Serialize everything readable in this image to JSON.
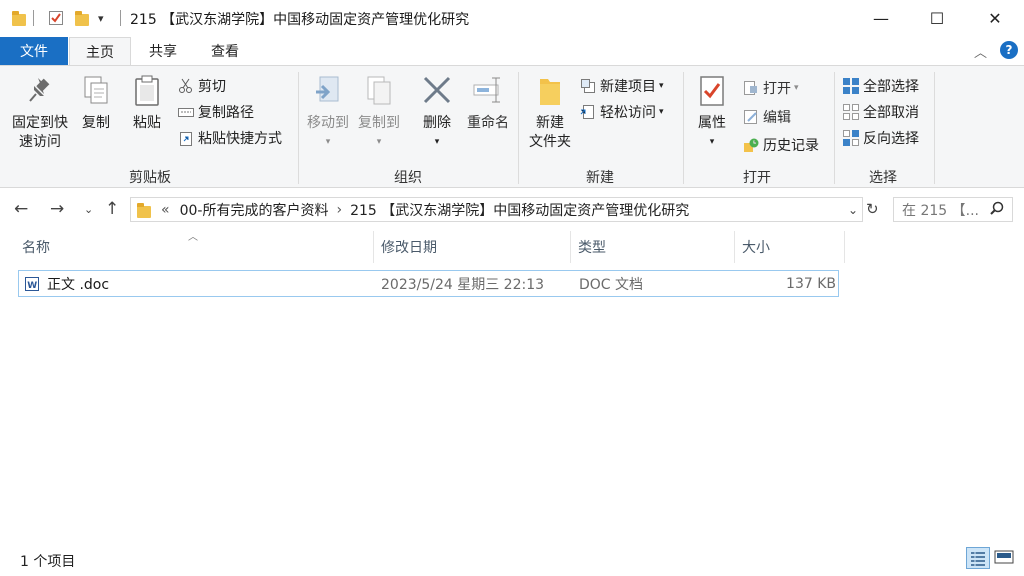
{
  "window": {
    "title": "215 【武汉东湖学院】中国移动固定资产管理优化研究",
    "minimize": "—",
    "maximize": "☐",
    "close": "✕"
  },
  "tabs": [
    {
      "label": "文件"
    },
    {
      "label": "主页"
    },
    {
      "label": "共享"
    },
    {
      "label": "查看"
    }
  ],
  "ribbon": {
    "clipboard": {
      "pin": "固定到快\n速访问",
      "pin_line1": "固定到快",
      "pin_line2": "速访问",
      "copy": "复制",
      "paste": "粘贴",
      "cut": "剪切",
      "copy_path": "复制路径",
      "paste_shortcut": "粘贴快捷方式",
      "label": "剪贴板"
    },
    "organize": {
      "move_to": "移动到",
      "copy_to": "复制到",
      "delete": "删除",
      "rename": "重命名",
      "label": "组织"
    },
    "new": {
      "new_folder_line1": "新建",
      "new_folder_line2": "文件夹",
      "new_item": "新建项目",
      "easy_access": "轻松访问",
      "label": "新建"
    },
    "open": {
      "properties": "属性",
      "open": "打开",
      "edit": "编辑",
      "history": "历史记录",
      "label": "打开"
    },
    "select": {
      "select_all": "全部选择",
      "select_none": "全部取消",
      "invert": "反向选择",
      "label": "选择"
    }
  },
  "address": {
    "overflow": "«",
    "crumbs": [
      "00-所有完成的客户资料",
      "215 【武汉东湖学院】中国移动固定资产管理优化研究"
    ],
    "search_placeholder": "在 215 【..."
  },
  "columns": [
    "名称",
    "修改日期",
    "类型",
    "大小"
  ],
  "files": [
    {
      "name": "正文 .doc",
      "modified": "2023/5/24 星期三 22:13",
      "type": "DOC 文档",
      "size": "137 KB"
    }
  ],
  "status": {
    "count": "1 个项目"
  },
  "colors": {
    "accent": "#1a6fc4",
    "selection_border": "#99c9ef"
  }
}
